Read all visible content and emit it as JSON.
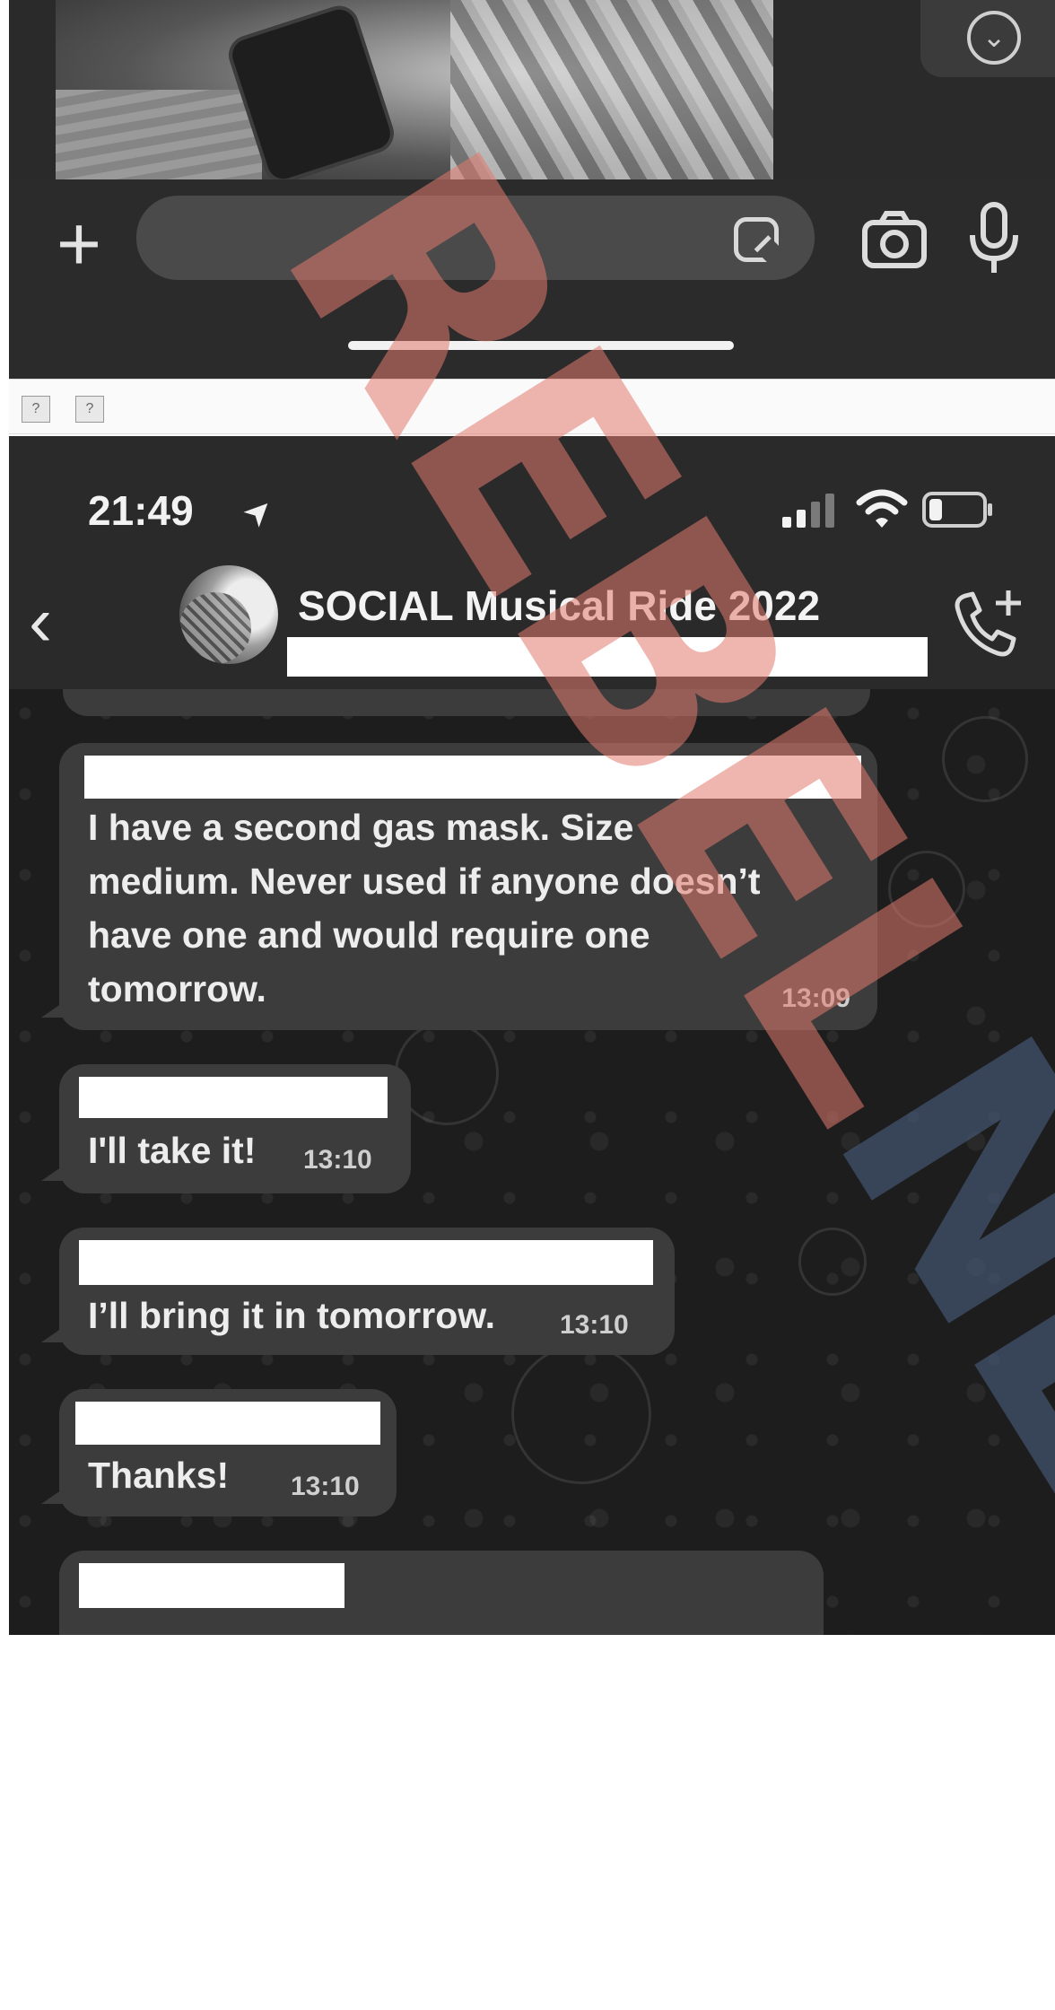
{
  "top_screenshot": {
    "scroll_down_icon": "chevron-down-circle-icon",
    "add_icon": "plus-icon",
    "add_glyph": "+",
    "sticker_icon": "sticker-icon",
    "camera_icon": "camera-icon",
    "mic_icon": "microphone-icon",
    "broken_images": [
      "?",
      "?"
    ]
  },
  "status_bar": {
    "time": "21:49",
    "location_glyph": "➤",
    "signal_bars_active": 2,
    "battery_fraction": 0.25
  },
  "chat_header": {
    "back_glyph": "‹",
    "group_name": "SOCIAL Musical Ride 2022",
    "add_call_icon": "phone-plus-icon"
  },
  "messages": [
    {
      "text_lines": [
        "I have a second gas mask. Size",
        "medium. Never used if anyone doesn’t",
        "have one and would require one",
        "tomorrow."
      ],
      "time": "13:09"
    },
    {
      "text_lines": [
        "I'll take it!"
      ],
      "time": "13:10"
    },
    {
      "text_lines": [
        "I’ll bring it in tomorrow."
      ],
      "time": "13:10"
    },
    {
      "text_lines": [
        "Thanks!"
      ],
      "time": "13:10"
    }
  ],
  "watermark": {
    "text_part1": "REBEL",
    "text_part2": "NEWS",
    "color_part1": "#e2786e",
    "color_part2": "#465a78"
  }
}
